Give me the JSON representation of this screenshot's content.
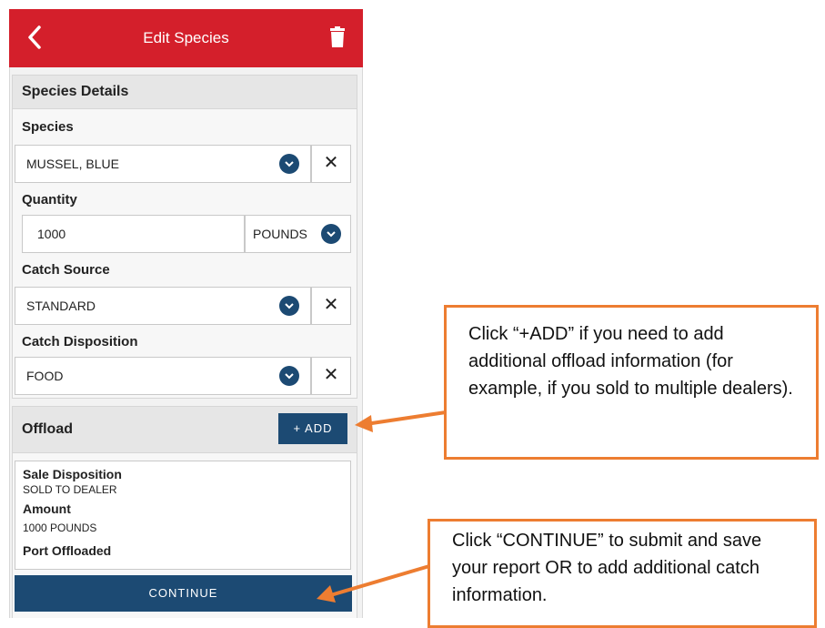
{
  "topbar": {
    "title": "Edit Species"
  },
  "species_details": {
    "header": "Species Details",
    "species_label": "Species",
    "species_value": "MUSSEL, BLUE",
    "quantity_label": "Quantity",
    "quantity_value": "1000",
    "quantity_unit": "POUNDS",
    "catch_source_label": "Catch Source",
    "catch_source_value": "STANDARD",
    "catch_disposition_label": "Catch Disposition",
    "catch_disposition_value": "FOOD",
    "clear_symbol": "✕"
  },
  "offload": {
    "header": "Offload",
    "add_label": "+ ADD",
    "entries": [
      {
        "sale_disposition_label": "Sale Disposition",
        "sale_disposition_value": "SOLD TO DEALER",
        "amount_label": "Amount",
        "amount_value": "1000 POUNDS",
        "port_label": "Port Offloaded"
      }
    ]
  },
  "continue_label": "CONTINUE",
  "callouts": {
    "add_note": "Click “+ADD” if you need to add additional offload information (for example, if you sold to multiple dealers).",
    "continue_note": "Click “CONTINUE” to submit and save your report OR to add additional catch information."
  },
  "colors": {
    "header_red": "#d41f2b",
    "primary_blue": "#1c4a73",
    "callout_orange": "#ed7d31"
  },
  "icons": [
    "back-chevron-icon",
    "trash-icon",
    "chevron-down-icon",
    "close-icon"
  ]
}
